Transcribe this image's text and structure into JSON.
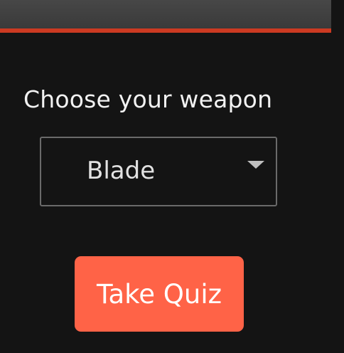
{
  "header": {
    "accent_color": "#cc3a22",
    "bar_color": "#444444"
  },
  "weapon": {
    "prompt": "Choose your weapon",
    "selected": "Blade",
    "dropdown_icon": "chevron-down-icon"
  },
  "actions": {
    "take_quiz_label": "Take Quiz",
    "button_color": "#ff6347"
  },
  "theme": {
    "background": "#141414",
    "text_color": "#f2f2f2"
  }
}
